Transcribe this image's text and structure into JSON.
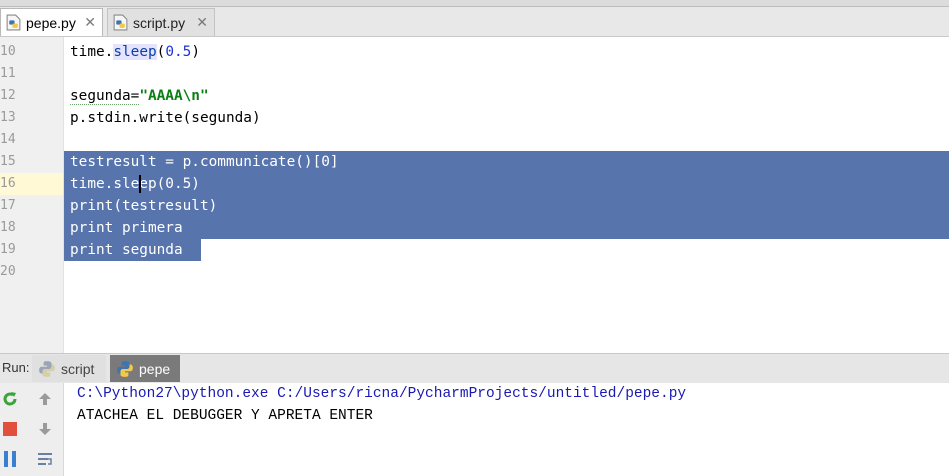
{
  "editor_tabs": [
    {
      "label": "pepe.py",
      "active": true
    },
    {
      "label": "script.py",
      "active": false
    }
  ],
  "close_glyph": "✕",
  "line_numbers": [
    "10",
    "11",
    "12",
    "13",
    "14",
    "15",
    "16",
    "17",
    "18",
    "19",
    "20"
  ],
  "code": {
    "l10": {
      "a": "time.",
      "fn": "sleep",
      "b": "(",
      "num": "0.5",
      "c": ")"
    },
    "l12": {
      "a": "segunda=",
      "str": "\"AAAA\\n\""
    },
    "l13": "p.stdin.write(segunda)",
    "l15": "testresult = p.communicate()[0]",
    "l16": "time.sleep(0.5)",
    "l17": "print(testresult)",
    "l18": "print primera",
    "l19": "print segunda"
  },
  "run_panel": {
    "label": "Run:",
    "tabs": [
      {
        "label": "script",
        "active": false
      },
      {
        "label": "pepe",
        "active": true
      }
    ]
  },
  "console": {
    "command": "C:\\Python27\\python.exe C:/Users/ricna/PycharmProjects/untitled/pepe.py",
    "output": "ATACHEA EL DEBUGGER Y APRETA ENTER"
  },
  "colors": {
    "selection": "#5874ac",
    "command_text": "#1919b4",
    "string_literal": "#0b7f14",
    "number_literal": "#1b34d6"
  },
  "icons": [
    "python-file-icon",
    "close-icon",
    "rerun-icon",
    "stop-icon",
    "pause-icon",
    "scroll-up-icon",
    "scroll-down-icon",
    "soft-wrap-icon"
  ]
}
